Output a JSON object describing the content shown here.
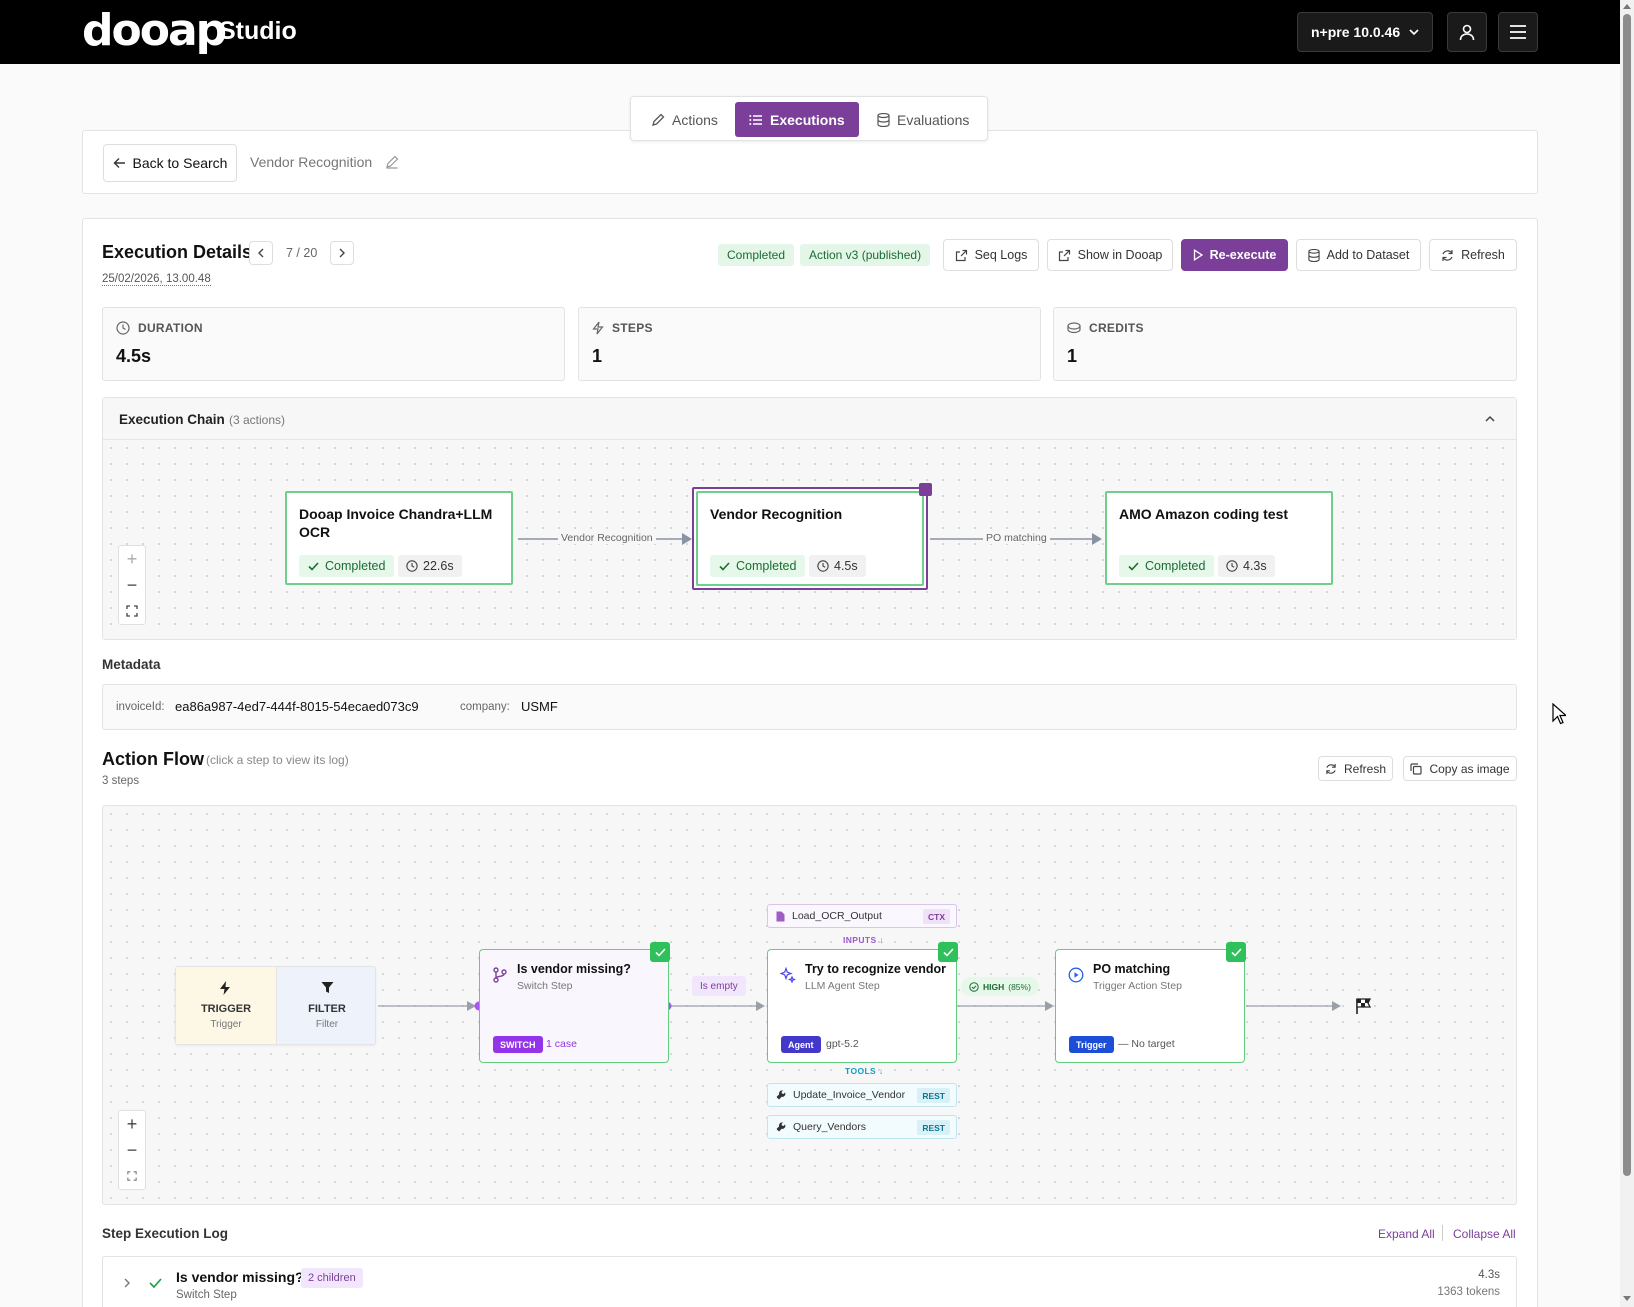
{
  "app": {
    "logo": "dooap",
    "product": "Studio",
    "env": "n+pre 10.0.46"
  },
  "tabs": [
    {
      "label": "Actions"
    },
    {
      "label": "Executions"
    },
    {
      "label": "Evaluations"
    }
  ],
  "header": {
    "back_label": "Back to Search",
    "action_name": "Vendor Recognition"
  },
  "execution": {
    "title": "Execution Details",
    "pager": "7 / 20",
    "timestamp": "25/02/2026, 13.00.48",
    "status": "Completed",
    "version": "Action v3 (published)",
    "buttons": {
      "seq_logs": "Seq Logs",
      "show_in_dooap": "Show in Dooap",
      "reexecute": "Re-execute",
      "add_dataset": "Add to Dataset",
      "refresh": "Refresh"
    },
    "stats": [
      {
        "label": "DURATION",
        "value": "4.5s"
      },
      {
        "label": "STEPS",
        "value": "1"
      },
      {
        "label": "CREDITS",
        "value": "1"
      }
    ]
  },
  "chain": {
    "title": "Execution Chain",
    "count": "(3 actions)",
    "nodes": [
      {
        "title": "Dooap Invoice Chandra+LLM OCR",
        "status": "Completed",
        "time": "22.6s"
      },
      {
        "title": "Vendor Recognition",
        "status": "Completed",
        "time": "4.5s"
      },
      {
        "title": "AMO Amazon coding test",
        "status": "Completed",
        "time": "4.3s"
      }
    ],
    "edges": [
      "Vendor Recognition",
      "PO matching"
    ]
  },
  "metadata": {
    "title": "Metadata",
    "items": [
      {
        "key": "invoiceId:",
        "value": "ea86a987-4ed7-444f-8015-54ecaed073c9"
      },
      {
        "key": "company:",
        "value": "USMF"
      }
    ]
  },
  "flow": {
    "title": "Action Flow",
    "hint": "(click a step to view its log)",
    "steps_count": "3 steps",
    "buttons": {
      "refresh": "Refresh",
      "copy": "Copy as image"
    },
    "trigger": {
      "title": "TRIGGER",
      "sub": "Trigger"
    },
    "filter": {
      "title": "FILTER",
      "sub": "Filter"
    },
    "edge_label": "Is empty",
    "confidence": {
      "level": "HIGH",
      "pct": "(85%)"
    },
    "inputs_label": "INPUTS",
    "tools_label": "TOOLS",
    "context": {
      "name": "Load_OCR_Output",
      "tag": "CTX"
    },
    "tools": [
      {
        "name": "Update_Invoice_Vendor",
        "tag": "REST"
      },
      {
        "name": "Query_Vendors",
        "tag": "REST"
      }
    ],
    "nodes": [
      {
        "title": "Is vendor missing?",
        "sub": "Switch Step",
        "pill": "SWITCH",
        "extra": "1 case"
      },
      {
        "title": "Try to recognize vendor",
        "sub": "LLM Agent Step",
        "pill": "Agent",
        "extra": "gpt-5.2"
      },
      {
        "title": "PO matching",
        "sub": "Trigger Action Step",
        "pill": "Trigger",
        "extra": "— No target"
      }
    ]
  },
  "log": {
    "title": "Step Execution Log",
    "expand": "Expand All",
    "collapse": "Collapse All",
    "rows": [
      {
        "title": "Is vendor missing?",
        "badge": "2 children",
        "sub": "Switch Step",
        "time": "4.3s",
        "tokens": "1363 tokens"
      }
    ]
  }
}
